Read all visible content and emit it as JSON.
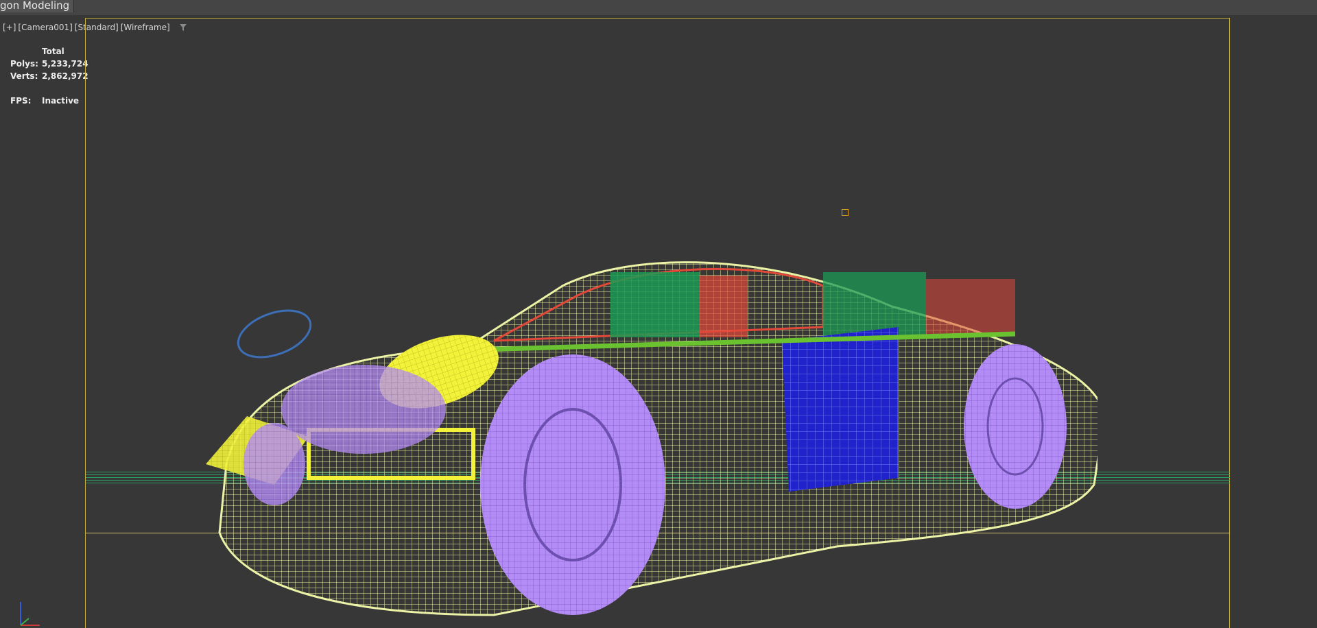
{
  "ribbon": {
    "active_tab": "gon Modeling"
  },
  "viewport": {
    "plus": "[+]",
    "camera": "[Camera001]",
    "shading": "[Standard]",
    "mode": "[Wireframe]",
    "filter_icon": "filter-funnel-icon"
  },
  "stats": {
    "header": "Total",
    "polys_label": "Polys:",
    "polys_value": "5,233,724",
    "verts_label": "Verts:",
    "verts_value": "2,862,972",
    "fps_label": "FPS:",
    "fps_value": "Inactive"
  },
  "colors": {
    "background": "#373737",
    "safe_frame": "#c9b03a",
    "wire_body": "#ecf3a6",
    "wire_wheels": "#b48cf5",
    "wire_glass_green": "#1c9a55",
    "wire_red": "#e2493a",
    "wire_blue": "#2222cc",
    "wire_yellow": "#f2f23a",
    "ground": "#2c9a63",
    "target": "#e3a020"
  }
}
